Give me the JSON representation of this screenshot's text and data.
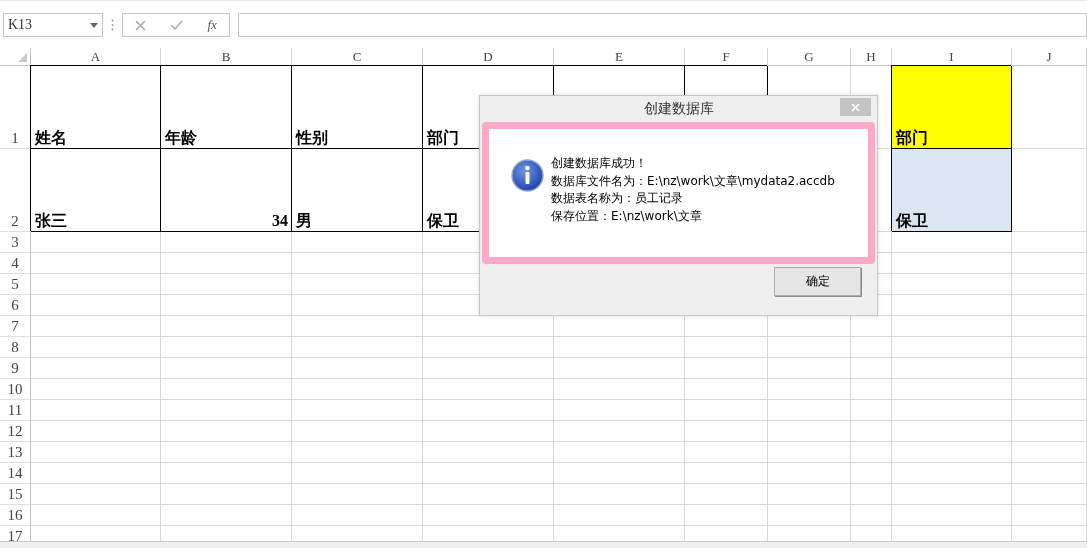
{
  "formula_bar": {
    "name_box": "K13",
    "function_button": "fx"
  },
  "sheet": {
    "columns": [
      "A",
      "B",
      "C",
      "D",
      "E",
      "F",
      "G",
      "H",
      "I",
      "J"
    ],
    "rows": [
      {
        "header": "1",
        "cells": [
          {
            "kind": "text",
            "text": "姓名"
          },
          {
            "kind": "text",
            "text": "年龄"
          },
          {
            "kind": "text",
            "text": "性别"
          },
          {
            "kind": "text",
            "text": "部门"
          },
          {
            "kind": "empty",
            "bordered": true
          },
          {
            "kind": "empty",
            "bordered": true
          },
          {
            "kind": "empty",
            "bordered": false
          },
          {
            "kind": "empty",
            "bordered": false
          },
          {
            "kind": "text",
            "text": "部门",
            "color": "#ffff00"
          },
          {
            "kind": "empty",
            "bordered": false
          }
        ]
      },
      {
        "header": "2",
        "cells": [
          {
            "kind": "text",
            "text": "张三"
          },
          {
            "kind": "number",
            "text": "34"
          },
          {
            "kind": "text",
            "text": "男"
          },
          {
            "kind": "text",
            "text": "保卫"
          },
          {
            "kind": "empty"
          },
          {
            "kind": "empty"
          },
          {
            "kind": "empty"
          },
          {
            "kind": "empty",
            "bordered": false
          },
          {
            "kind": "text",
            "text": "保卫",
            "color": "#dce6f1"
          },
          {
            "kind": "empty",
            "bordered": false
          }
        ]
      },
      {
        "header": "3"
      },
      {
        "header": "4"
      },
      {
        "header": "5"
      },
      {
        "header": "6"
      },
      {
        "header": "7"
      },
      {
        "header": "8"
      },
      {
        "header": "9"
      },
      {
        "header": "10"
      },
      {
        "header": "11"
      },
      {
        "header": "12"
      },
      {
        "header": "13"
      },
      {
        "header": "14"
      },
      {
        "header": "15"
      },
      {
        "header": "16"
      },
      {
        "header": "17"
      }
    ]
  },
  "dialog": {
    "title": "创建数据库",
    "highlighted": true,
    "message": [
      "创建数据库成功！",
      "数据库文件名为：E:\\nz\\work\\文章\\mydata2.accdb",
      "数据表名称为：员工记录",
      "保存位置：E:\\nz\\work\\文章"
    ],
    "ok_button": "确定"
  }
}
